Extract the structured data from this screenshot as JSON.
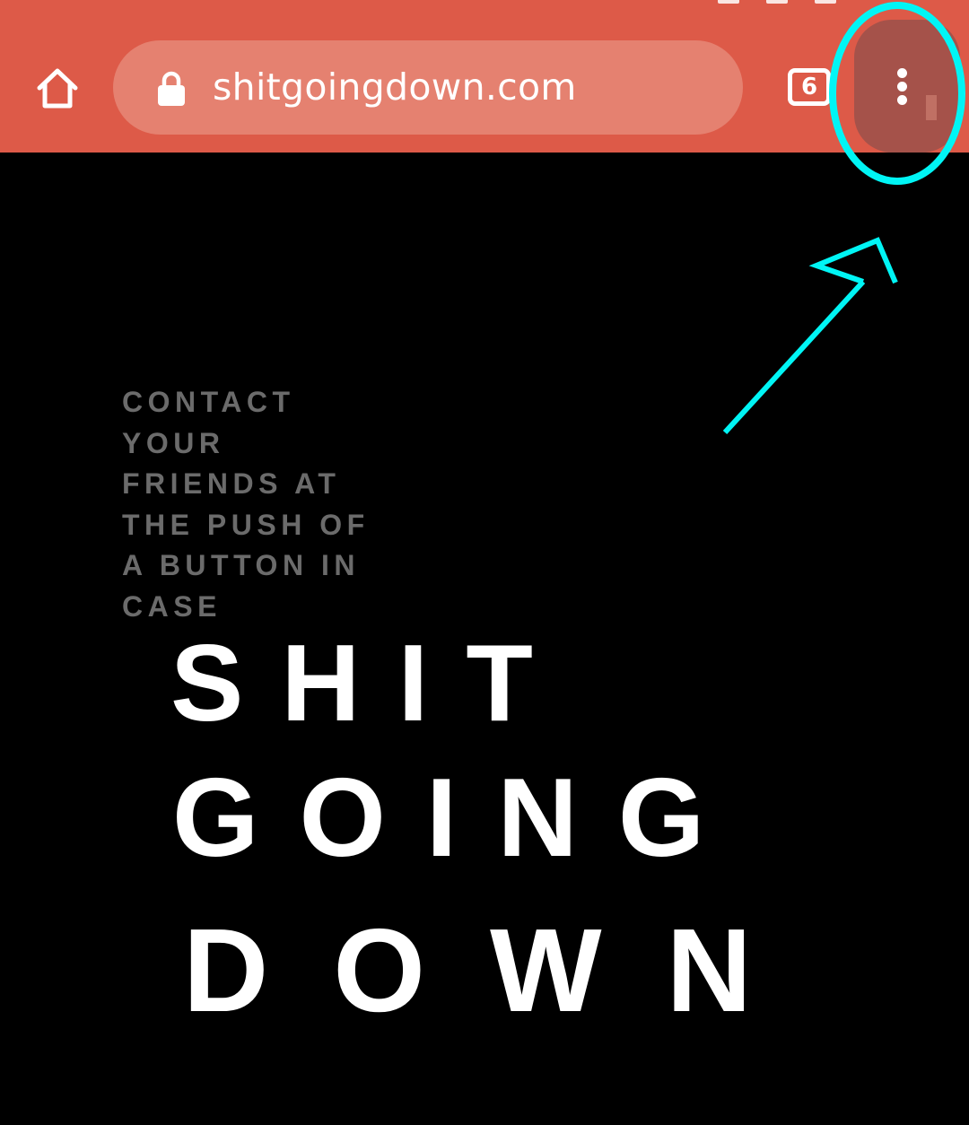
{
  "browser": {
    "url": "shitgoingdown.com",
    "tab_count": "6",
    "theme_color": "#dd5a48",
    "icons": {
      "home": "home-icon",
      "lock": "lock-icon",
      "tabs": "tab-switcher-icon",
      "menu": "more-vert-icon"
    }
  },
  "page": {
    "tagline": "CONTACT YOUR FRIENDS AT THE PUSH OF A BUTTON IN CASE",
    "headline": {
      "line1": "SHIT",
      "line2": "GOING",
      "line3": "DOWN"
    }
  },
  "annotation": {
    "color": "#00f5f5",
    "target": "menu-button"
  }
}
